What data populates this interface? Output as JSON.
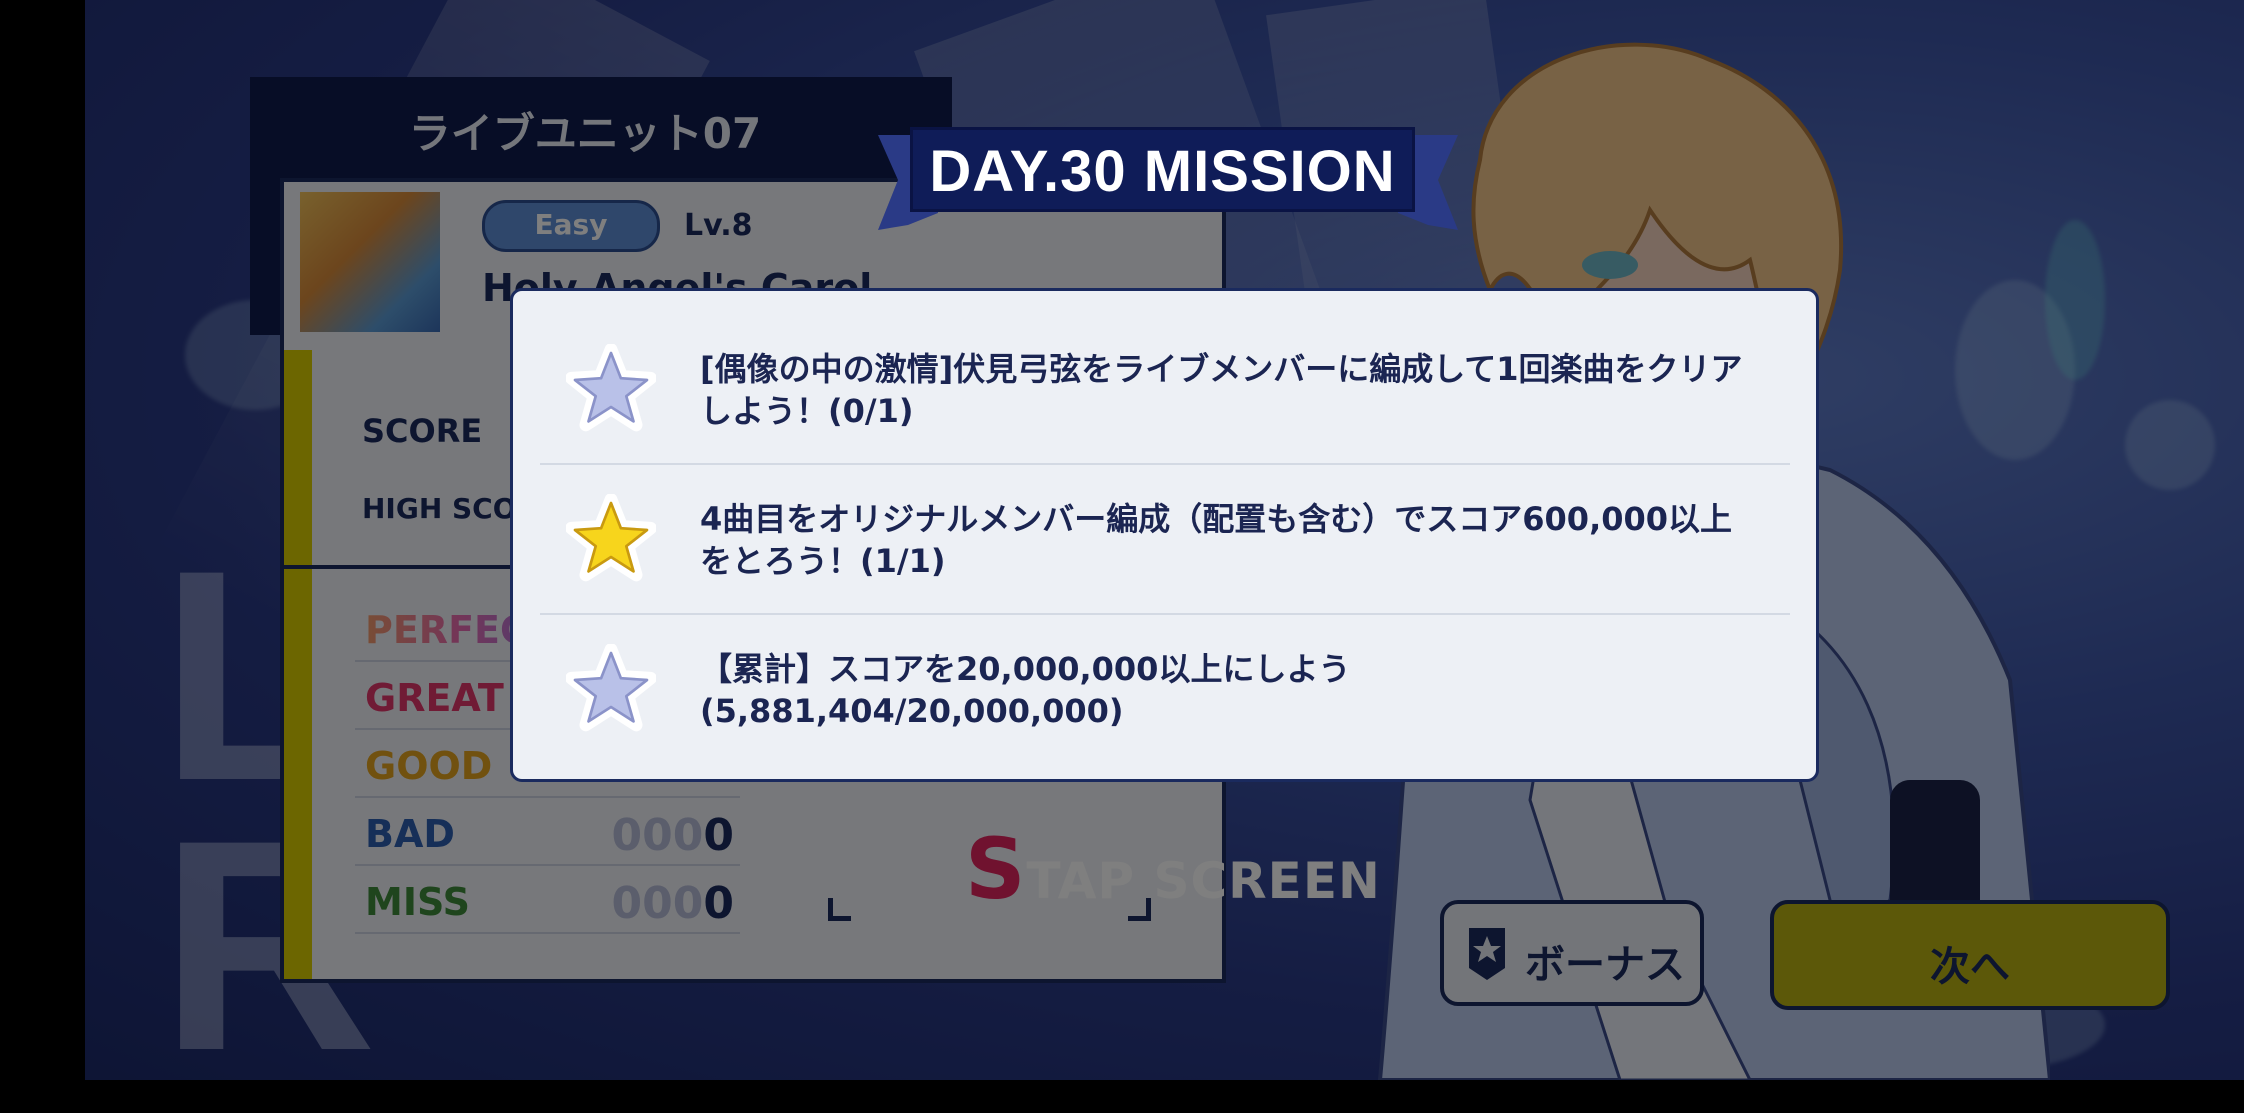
{
  "result": {
    "unit_title": "ライブユニット07",
    "difficulty": "Easy",
    "level": "Lv.8",
    "song_title": "Holy Angel's Carol",
    "score_label": "SCORE",
    "high_score_label": "HIGH SCORE",
    "judgements": [
      {
        "label": "PERFECT",
        "ghost": "",
        "value": ""
      },
      {
        "label": "GREAT",
        "ghost": "",
        "value": ""
      },
      {
        "label": "GOOD",
        "ghost": "",
        "value": ""
      },
      {
        "label": "BAD",
        "ghost": "000",
        "value": "0"
      },
      {
        "label": "MISS",
        "ghost": "000",
        "value": "0"
      }
    ],
    "background_text_1": "L",
    "background_text_2": "R"
  },
  "tap_screen": {
    "s": "S",
    "label": "TAP SCREEN"
  },
  "buttons": {
    "bonus": "ボーナス",
    "next": "次へ"
  },
  "mission": {
    "title": "DAY.30 MISSION",
    "items": [
      {
        "text": "[偶像の中の激情]伏見弓弦をライブメンバーに編成して1回楽曲をクリアしよう！(0/1)",
        "completed": false
      },
      {
        "text": "4曲目をオリジナルメンバー編成（配置も含む）でスコア600,000以上をとろう！(1/1)",
        "completed": true
      },
      {
        "text": "【累計】スコアを20,000,000以上にしよう(5,881,404/20,000,000)",
        "completed": false
      }
    ]
  },
  "colors": {
    "navy": "#1a2a5e",
    "star_completed": "#f7d51c",
    "star_incomplete": "#b9c1e8",
    "next_button": "#b9b012"
  }
}
